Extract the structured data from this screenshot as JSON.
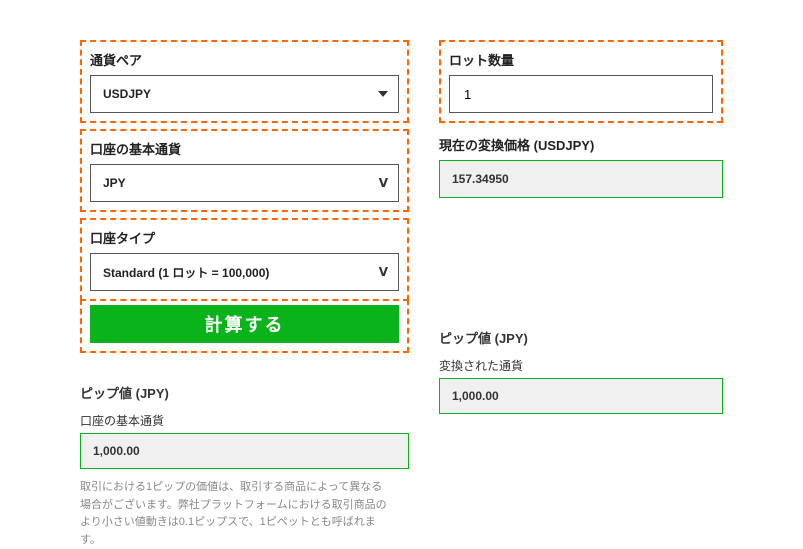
{
  "left": {
    "pair": {
      "label": "通貨ペア",
      "value": "USDJPY"
    },
    "base": {
      "label": "口座の基本通貨",
      "value": "JPY"
    },
    "type": {
      "label": "口座タイプ",
      "value": "Standard (1 ロット = 100,000)"
    },
    "submit": "計算する"
  },
  "right": {
    "lots": {
      "label": "ロット数量",
      "value": "1"
    },
    "rate": {
      "label": "現在の変換価格 (USDJPY)",
      "value": "157.34950"
    }
  },
  "results": {
    "left": {
      "title": "ピップ値 (JPY)",
      "sub": "口座の基本通貨",
      "value": "1,000.00"
    },
    "right": {
      "title": "ピップ値 (JPY)",
      "sub": "変換された通貨",
      "value": "1,000.00"
    }
  },
  "footnote": "取引における1ピップの価値は、取引する商品によって異なる場合がございます。弊社プラットフォームにおける取引商品のより小さい値動きは0.1ピップスで、1ピペットとも呼ばれます。"
}
